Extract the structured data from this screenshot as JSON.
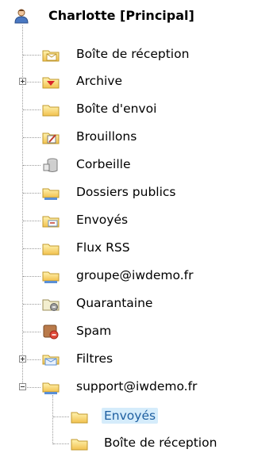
{
  "tree": {
    "root": {
      "label": "Charlotte [Principal]",
      "icon": "user-icon"
    },
    "folders": [
      {
        "label": "Boîte de réception",
        "icon": "inbox-folder-icon"
      },
      {
        "label": "Archive",
        "icon": "archive-folder-icon",
        "expander": "collapsed"
      },
      {
        "label": "Boîte d'envoi",
        "icon": "folder-icon"
      },
      {
        "label": "Brouillons",
        "icon": "drafts-folder-icon"
      },
      {
        "label": "Corbeille",
        "icon": "trash-icon"
      },
      {
        "label": "Dossiers publics",
        "icon": "public-folders-icon"
      },
      {
        "label": "Envoyés",
        "icon": "sent-folder-icon"
      },
      {
        "label": "Flux RSS",
        "icon": "folder-icon"
      },
      {
        "label": "groupe@iwdemo.fr",
        "icon": "shared-folder-icon"
      },
      {
        "label": "Quarantaine",
        "icon": "quarantine-folder-icon"
      },
      {
        "label": "Spam",
        "icon": "spam-folder-icon"
      },
      {
        "label": "Filtres",
        "icon": "filters-folder-icon",
        "expander": "collapsed"
      },
      {
        "label": "support@iwdemo.fr",
        "icon": "shared-folder-icon",
        "expander": "expanded"
      }
    ],
    "subfolders": [
      {
        "label": "Envoyés",
        "icon": "folder-icon",
        "selected": true
      },
      {
        "label": "Boîte de réception",
        "icon": "folder-icon"
      }
    ]
  }
}
